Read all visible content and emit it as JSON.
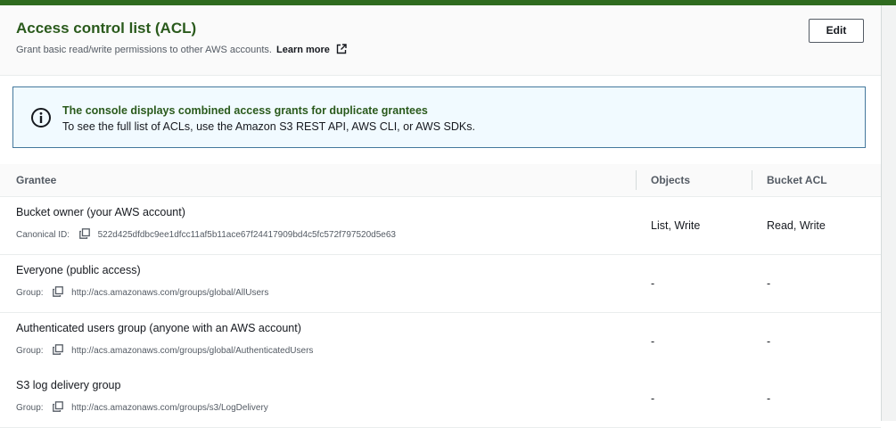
{
  "header": {
    "title": "Access control list (ACL)",
    "subtitle": "Grant basic read/write permissions to other AWS accounts.",
    "learn_more": "Learn more",
    "edit_label": "Edit"
  },
  "info": {
    "title": "The console displays combined access grants for duplicate grantees",
    "body": "To see the full list of ACLs, use the Amazon S3 REST API, AWS CLI, or AWS SDKs."
  },
  "table": {
    "columns": [
      "Grantee",
      "Objects",
      "Bucket ACL"
    ],
    "rows": [
      {
        "name": "Bucket owner (your AWS account)",
        "id_label": "Canonical ID:",
        "id_value": "522d425dfdbc9ee1dfcc11af5b11ace67f24417909bd4c5fc572f797520d5e63",
        "objects": "List, Write",
        "bucket_acl": "Read, Write"
      },
      {
        "name": "Everyone (public access)",
        "id_label": "Group:",
        "id_value": "http://acs.amazonaws.com/groups/global/AllUsers",
        "objects": "-",
        "bucket_acl": "-"
      },
      {
        "name": "Authenticated users group (anyone with an AWS account)",
        "id_label": "Group:",
        "id_value": "http://acs.amazonaws.com/groups/global/AuthenticatedUsers",
        "objects": "-",
        "bucket_acl": "-"
      },
      {
        "name": "S3 log delivery group",
        "id_label": "Group:",
        "id_value": "http://acs.amazonaws.com/groups/s3/LogDelivery",
        "objects": "-",
        "bucket_acl": "-"
      }
    ]
  },
  "colors": {
    "top_bar": "#2f6b1f",
    "title": "#2a5a1c",
    "info_border": "#44789d",
    "info_bg": "#f1faff"
  },
  "icons": [
    "external-link-icon",
    "info-icon",
    "copy-icon"
  ]
}
